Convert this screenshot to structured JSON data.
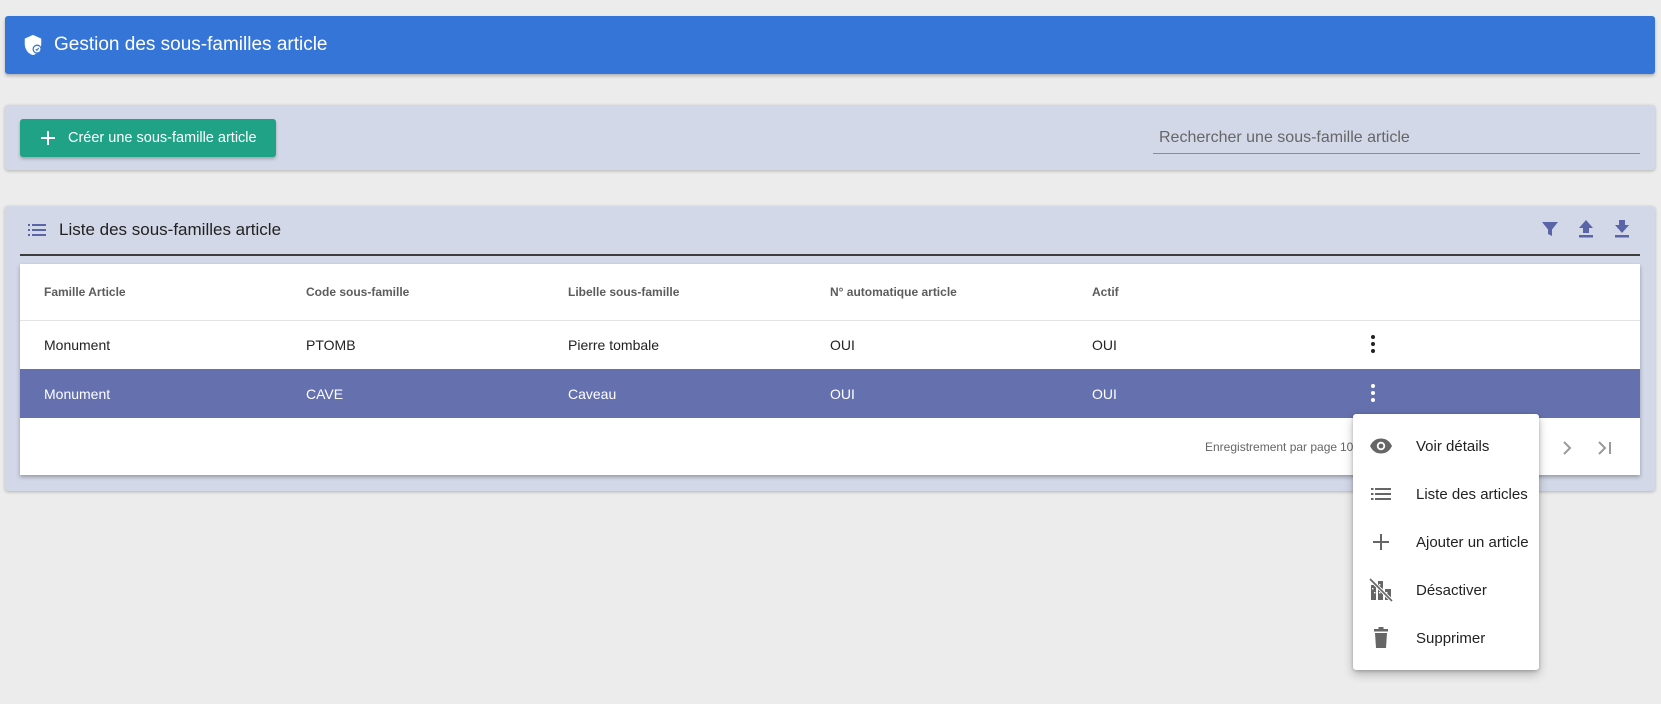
{
  "header": {
    "title": "Gestion des sous-familles article",
    "icon": "shield-icon"
  },
  "toolbar": {
    "create_label": "Créer une sous-famille article",
    "search_placeholder": "Rechercher une sous-famille article"
  },
  "list": {
    "title": "Liste des sous-familles article",
    "actions": [
      "filter-icon",
      "upload-icon",
      "download-icon"
    ]
  },
  "table": {
    "columns": [
      "Famille Article",
      "Code sous-famille",
      "Libelle sous-famille",
      "N° automatique article",
      "Actif"
    ],
    "rows": [
      {
        "famille": "Monument",
        "code": "PTOMB",
        "libelle": "Pierre tombale",
        "auto": "OUI",
        "actif": "OUI"
      },
      {
        "famille": "Monument",
        "code": "CAVE",
        "libelle": "Caveau",
        "auto": "OUI",
        "actif": "OUI"
      }
    ]
  },
  "pagination": {
    "label": "Enregistrement par page",
    "value": "10"
  },
  "menu": {
    "items": [
      {
        "label": "Voir détails",
        "icon": "eye-icon"
      },
      {
        "label": "Liste des articles",
        "icon": "list-icon"
      },
      {
        "label": "Ajouter un article",
        "icon": "plus-icon"
      },
      {
        "label": "Désactiver",
        "icon": "deactivate-icon"
      },
      {
        "label": "Supprimer",
        "icon": "trash-icon"
      }
    ]
  },
  "colors": {
    "header": "#3575d7",
    "card": "#d3d8e8",
    "primary_button": "#1fa286",
    "selected_row": "#6471ae",
    "accent_icon": "#5965a8"
  }
}
